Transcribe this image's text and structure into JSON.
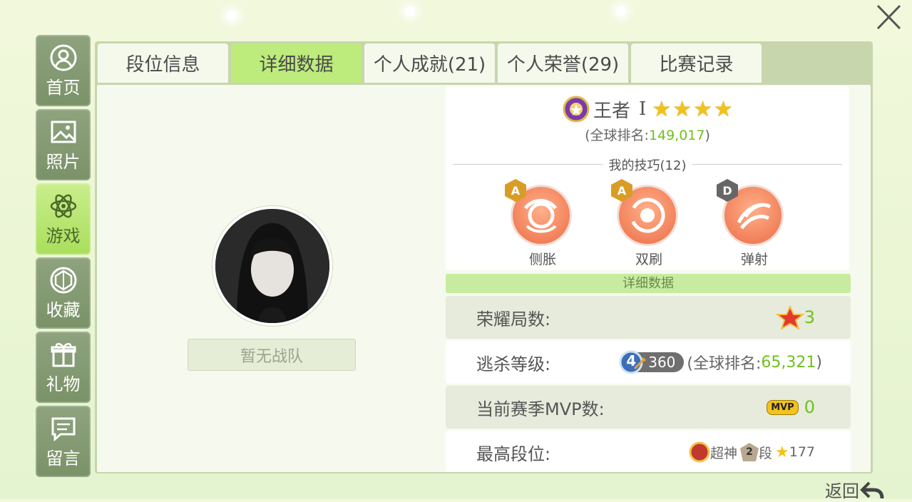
{
  "sidebar": {
    "items": [
      {
        "label": "首页",
        "icon": "home-user-icon"
      },
      {
        "label": "照片",
        "icon": "photo-icon"
      },
      {
        "label": "游戏",
        "icon": "atom-icon"
      },
      {
        "label": "收藏",
        "icon": "gem-icon"
      },
      {
        "label": "礼物",
        "icon": "gift-icon"
      },
      {
        "label": "留言",
        "icon": "message-icon"
      }
    ],
    "active": 2
  },
  "tabs": [
    {
      "label": "段位信息"
    },
    {
      "label": "详细数据"
    },
    {
      "label": "个人成就(21)"
    },
    {
      "label": "个人荣誉(29)"
    },
    {
      "label": "比赛记录"
    }
  ],
  "active_tab": 1,
  "profile": {
    "team": "暂无战队"
  },
  "rank": {
    "name": "王者",
    "tier": "I",
    "stars": 4,
    "global_prefix": "(全球排名:",
    "global_rank": "149,017",
    "global_suffix": ")"
  },
  "skills": {
    "title": "我的技巧(12)",
    "items": [
      {
        "label": "侧胀",
        "grade": "A"
      },
      {
        "label": "双刷",
        "grade": "A"
      },
      {
        "label": "弹射",
        "grade": "D"
      }
    ]
  },
  "details": {
    "header": "详细数据",
    "rows": [
      {
        "key": "荣耀局数:",
        "value": "3"
      },
      {
        "key": "逃杀等级:",
        "level": "4",
        "score": "360",
        "rank_prefix": "(全球排名:",
        "rank": "65,321",
        "rank_suffix": ")"
      },
      {
        "key": "当前赛季MVP数:",
        "badge": "MVP",
        "value": "0"
      },
      {
        "key": "最高段位:",
        "tier1": "超神",
        "tier2_num": "2",
        "tier2": "段",
        "stars": "177"
      }
    ]
  },
  "footer": {
    "back": "返回"
  },
  "colors": {
    "accent_green": "#6fc11f",
    "tab_active": "#bdeb7c",
    "skill_orange": "#ec6d46"
  }
}
